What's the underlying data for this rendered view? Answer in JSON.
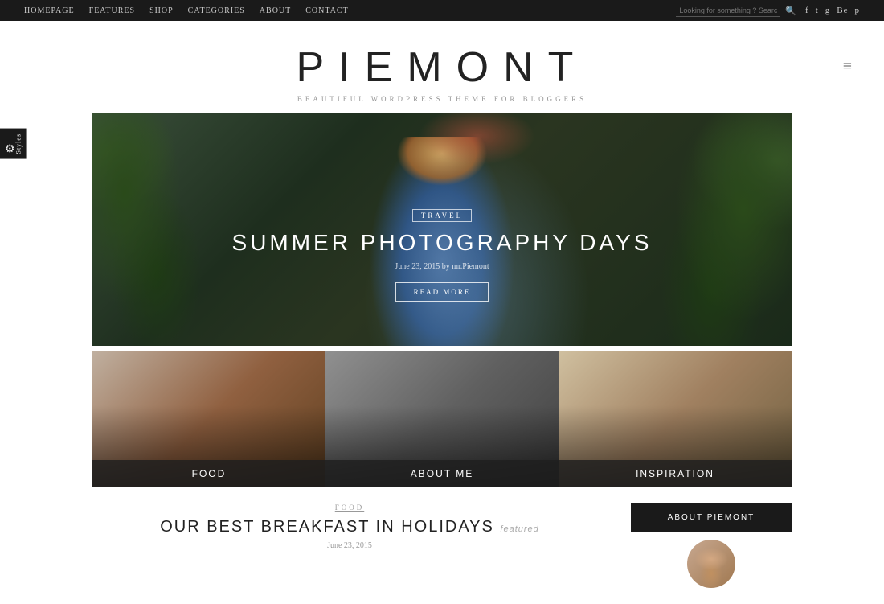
{
  "nav": {
    "links": [
      {
        "label": "HOMEPAGE",
        "id": "homepage"
      },
      {
        "label": "FEATURES",
        "id": "features"
      },
      {
        "label": "SHOP",
        "id": "shop"
      },
      {
        "label": "CATEGORIES",
        "id": "categories"
      },
      {
        "label": "ABOUT",
        "id": "about"
      },
      {
        "label": "CONTACT",
        "id": "contact"
      }
    ],
    "search_placeholder": "Looking for something ? Search away?",
    "social": [
      "f",
      "t",
      "g+",
      "Be",
      "p"
    ]
  },
  "header": {
    "title": "PIEMONT",
    "tagline": "BEAUTIFUL  WORDPRESS THEME FOR BLOGGERS",
    "hamburger": "≡"
  },
  "hero": {
    "category": "TRAVEL",
    "title": "SUMMER PHOTOGRAPHY DAYS",
    "meta": "June 23, 2015 by mr.Piemont",
    "cta": "READ MORE"
  },
  "grid": [
    {
      "label": "Food"
    },
    {
      "label": "About me"
    },
    {
      "label": "Inspiration"
    }
  ],
  "bottom": {
    "tag": "FOOD",
    "post_title": "OUR BEST BREAKFAST IN HOLIDAYS",
    "featured_badge": "featured",
    "post_date": "June 23, 2015",
    "about_btn": "ABOUT PIEMONT"
  },
  "styles_panel": {
    "icon": "⚙",
    "label": "Styles"
  }
}
